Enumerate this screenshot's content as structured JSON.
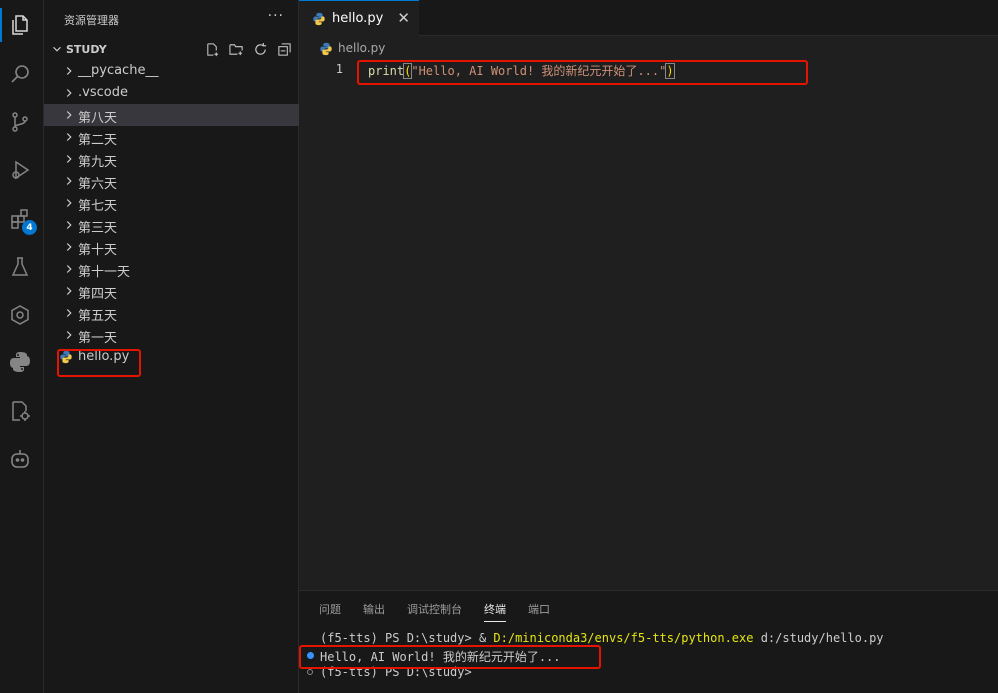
{
  "activity_bar": {
    "extensions_badge": "4"
  },
  "explorer": {
    "title": "资源管理器",
    "more": "···",
    "section": "STUDY",
    "folders": [
      "__pycache__",
      ".vscode",
      "第八天",
      "第二天",
      "第九天",
      "第六天",
      "第七天",
      "第三天",
      "第十天",
      "第十一天",
      "第四天",
      "第五天",
      "第一天"
    ],
    "file": "hello.py"
  },
  "editor": {
    "tab_label": "hello.py",
    "tab_close": "✕",
    "breadcrumb": "hello.py",
    "line_number": "1",
    "code_fn": "print",
    "code_open": "(",
    "code_str": "\"Hello, AI World! 我的新纪元开始了...\"",
    "code_close": ")"
  },
  "panel": {
    "tabs": [
      "问题",
      "输出",
      "调试控制台",
      "终端",
      "端口"
    ],
    "active_tab": "终端",
    "term_line1_prompt": "(f5-tts) PS D:\\study> & ",
    "term_line1_path": "D:/miniconda3/envs/f5-tts/python.exe",
    "term_line1_arg": " d:/study/hello.py",
    "term_line2": "Hello, AI World! 我的新纪元开始了...",
    "term_line3": "(f5-tts) PS D:\\study>"
  },
  "colors": {
    "accent": "#0078d4",
    "highlight": "#e51400",
    "python_blue": "#3d7ab8",
    "python_yellow": "#f2c94c"
  }
}
